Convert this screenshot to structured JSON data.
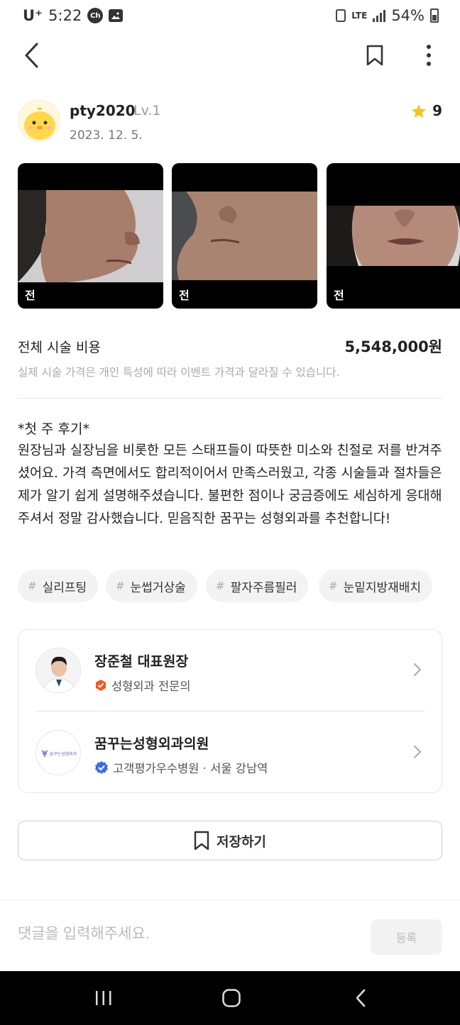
{
  "status_bar": {
    "carrier": "U⁺",
    "time": "5:22",
    "network": "LTE",
    "battery": "54%"
  },
  "author": {
    "name": "pty2020",
    "level": "Lv.1",
    "date": "2023. 12. 5.",
    "rating": "9"
  },
  "photos": [
    {
      "label": "전"
    },
    {
      "label": "전"
    },
    {
      "label": "전"
    }
  ],
  "cost": {
    "title": "전체 시술 비용",
    "value": "5,548,000원",
    "note": "실제 시술 가격은 개인 특성에 따라 이벤트 가격과 달라질 수 있습니다."
  },
  "review": {
    "title": "*첫 주 후기*",
    "body": "원장님과 실장님을 비롯한 모든 스태프들이 따뜻한 미소와 친절로 저를 반겨주셨어요. 가격 측면에서도 합리적이어서 만족스러웠고, 각종 시술들과 절차들은 제가 알기 쉽게 설명해주셨습니다. 불편한 점이나 궁금증에도 세심하게 응대해주셔서 정말 감사했습니다. 믿음직한 꿈꾸는 성형외과를 추천합니다!"
  },
  "tags": [
    "실리프팅",
    "눈썹거상술",
    "팔자주름필러",
    "눈밑지방재배치"
  ],
  "doctor": {
    "name": "장준철 대표원장",
    "specialty": "성형외과 전문의"
  },
  "clinic": {
    "name": "꿈꾸는성형외과의원",
    "logo_text": "꿈꾸는성형외과",
    "info": "고객평가우수병원 · 서울 강남역"
  },
  "save_button": {
    "label": "저장하기"
  },
  "comment": {
    "placeholder": "댓글을 입력해주세요.",
    "submit_label": "등록"
  },
  "colors": {
    "star": "#f7c31d",
    "specialist_badge": "#f05a28",
    "verified_badge": "#3b6fe0"
  }
}
